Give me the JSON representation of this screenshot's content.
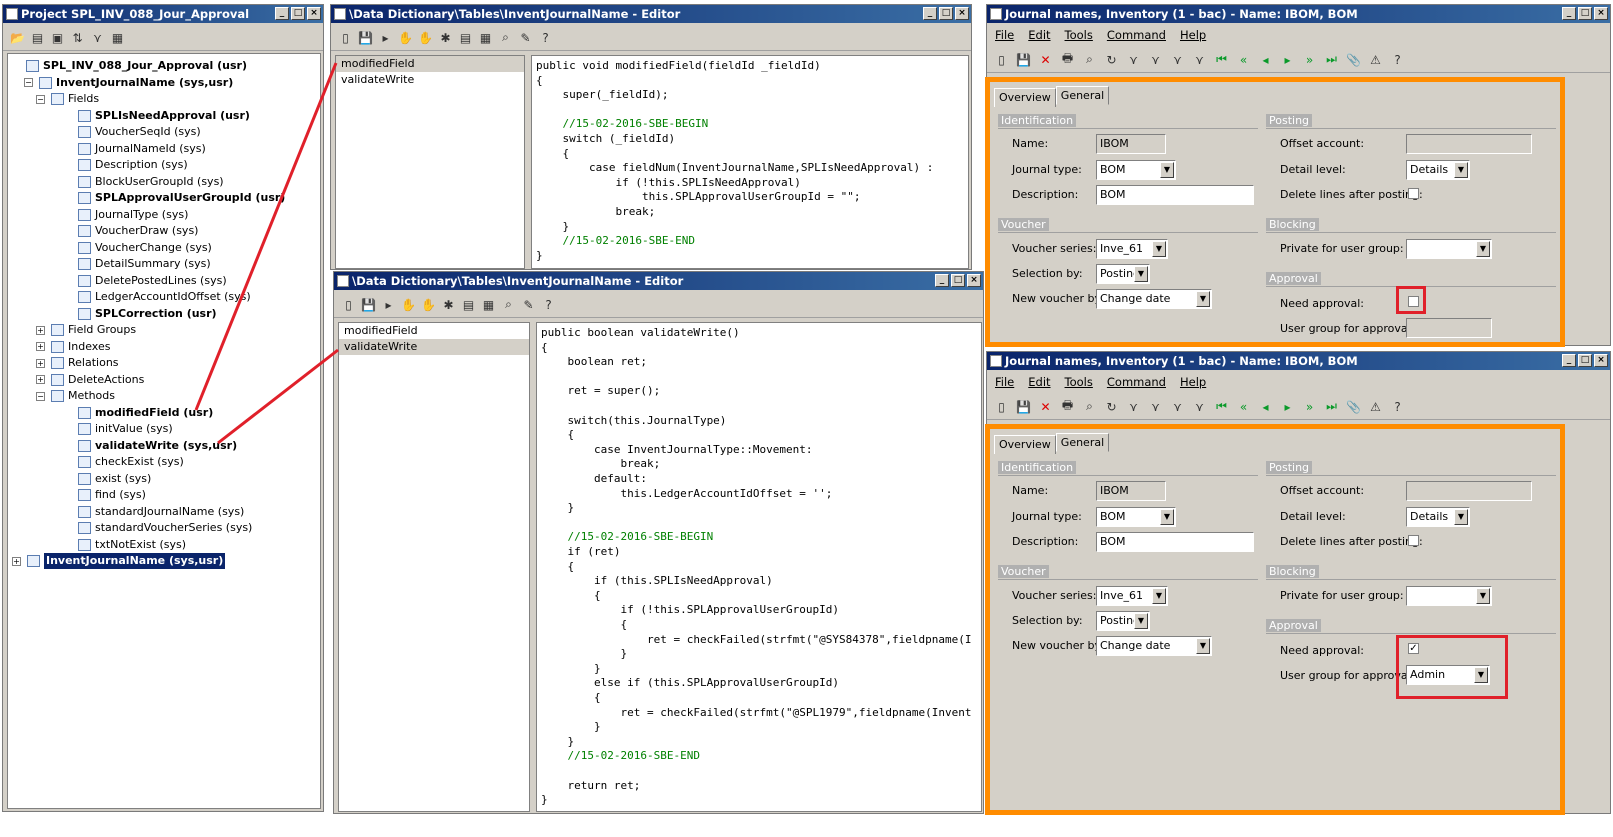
{
  "project": {
    "title": "Project SPL_INV_088_Jour_Approval",
    "tree": [
      {
        "label": "SPL_INV_088_Jour_Approval (usr)",
        "bold": true
      },
      {
        "label": "InventJournalName (sys,usr)",
        "bold": true
      },
      {
        "label": "Fields",
        "bold": false
      },
      {
        "label": "SPLIsNeedApproval (usr)",
        "bold": true
      },
      {
        "label": "VoucherSeqId (sys)",
        "bold": false
      },
      {
        "label": "JournalNameId (sys)",
        "bold": false
      },
      {
        "label": "Description (sys)",
        "bold": false
      },
      {
        "label": "BlockUserGroupId (sys)",
        "bold": false
      },
      {
        "label": "SPLApprovalUserGroupId (usr)",
        "bold": true
      },
      {
        "label": "JournalType (sys)",
        "bold": false
      },
      {
        "label": "VoucherDraw (sys)",
        "bold": false
      },
      {
        "label": "VoucherChange (sys)",
        "bold": false
      },
      {
        "label": "DetailSummary (sys)",
        "bold": false
      },
      {
        "label": "DeletePostedLines (sys)",
        "bold": false
      },
      {
        "label": "LedgerAccountIdOffset (sys)",
        "bold": false
      },
      {
        "label": "SPLCorrection (usr)",
        "bold": true
      },
      {
        "label": "Field Groups",
        "bold": false
      },
      {
        "label": "Indexes",
        "bold": false
      },
      {
        "label": "Relations",
        "bold": false
      },
      {
        "label": "DeleteActions",
        "bold": false
      },
      {
        "label": "Methods",
        "bold": false
      },
      {
        "label": "modifiedField (usr)",
        "bold": true
      },
      {
        "label": "initValue (sys)",
        "bold": false
      },
      {
        "label": "validateWrite (sys,usr)",
        "bold": true
      },
      {
        "label": "checkExist (sys)",
        "bold": false
      },
      {
        "label": "exist (sys)",
        "bold": false
      },
      {
        "label": "find (sys)",
        "bold": false
      },
      {
        "label": "standardJournalName (sys)",
        "bold": false
      },
      {
        "label": "standardVoucherSeries (sys)",
        "bold": false
      },
      {
        "label": "txtNotExist (sys)",
        "bold": false
      },
      {
        "label": "InventJournalName (sys,usr)",
        "bold": true
      }
    ]
  },
  "editor1": {
    "title": "\\Data Dictionary\\Tables\\InventJournalName - Editor",
    "methods": [
      "modifiedField",
      "validateWrite"
    ],
    "code": [
      "public void modifiedField(fieldId _fieldId)",
      "{",
      "    super(_fieldId);",
      "",
      "    //15-02-2016-SBE-BEGIN",
      "    switch (_fieldId)",
      "    {",
      "        case fieldNum(InventJournalName,SPLIsNeedApproval) :",
      "            if (!this.SPLIsNeedApproval)",
      "                this.SPLApprovalUserGroupId = \"\";",
      "            break;",
      "    }",
      "    //15-02-2016-SBE-END",
      "}"
    ]
  },
  "editor2": {
    "title": "\\Data Dictionary\\Tables\\InventJournalName - Editor",
    "methods": [
      "modifiedField",
      "validateWrite"
    ],
    "code": [
      "public boolean validateWrite()",
      "{",
      "    boolean ret;",
      "",
      "    ret = super();",
      "",
      "    switch(this.JournalType)",
      "    {",
      "        case InventJournalType::Movement:",
      "            break;",
      "        default:",
      "            this.LedgerAccountIdOffset = '';",
      "    }",
      "",
      "    //15-02-2016-SBE-BEGIN",
      "    if (ret)",
      "    {",
      "        if (this.SPLIsNeedApproval)",
      "        {",
      "            if (!this.SPLApprovalUserGroupId)",
      "            {",
      "                ret = checkFailed(strfmt(\"@SYS84378\",fieldpname(I",
      "            }",
      "        }",
      "        else if (this.SPLApprovalUserGroupId)",
      "        {",
      "            ret = checkFailed(strfmt(\"@SPL1979\",fieldpname(Invent",
      "        }",
      "    }",
      "    //15-02-2016-SBE-END",
      "",
      "    return ret;",
      "}"
    ]
  },
  "form": {
    "title": "Journal names, Inventory (1 - bac) - Name: IBOM, BOM",
    "menu": [
      "File",
      "Edit",
      "Tools",
      "Command",
      "Help"
    ],
    "tabs": [
      "Overview",
      "General"
    ],
    "groups": {
      "identification": "Identification",
      "posting": "Posting",
      "voucher": "Voucher",
      "blocking": "Blocking",
      "approval": "Approval"
    },
    "labels": {
      "name": "Name:",
      "journal_type": "Journal type:",
      "description": "Description:",
      "offset": "Offset account:",
      "detail": "Detail level:",
      "delete_lines": "Delete lines after posting:",
      "voucher_series": "Voucher series:",
      "selection_by": "Selection by:",
      "new_voucher": "New voucher by:",
      "private_group": "Private for user group:",
      "need_approval": "Need approval:",
      "user_group": "User group for approval:"
    },
    "values": {
      "name": "IBOM",
      "journal_type": "BOM",
      "description": "BOM",
      "detail": "Details",
      "voucher_series": "Inve_61",
      "selection_by": "Posting",
      "new_voucher": "Change date"
    },
    "top": {
      "need_approval": false,
      "user_group": ""
    },
    "bottom": {
      "need_approval": true,
      "user_group": "Admin"
    }
  }
}
